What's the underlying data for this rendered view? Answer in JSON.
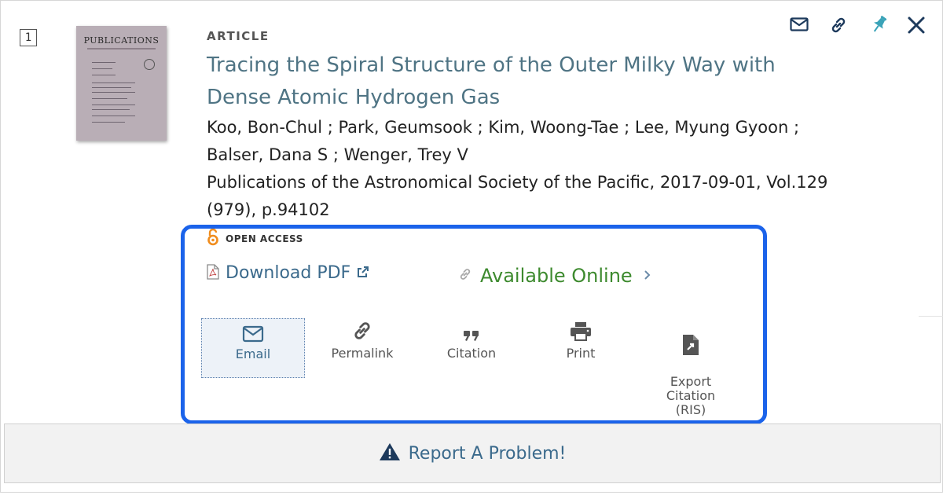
{
  "record": {
    "rank": "1",
    "type": "ARTICLE",
    "title": "Tracing the Spiral Structure of the Outer Milky Way with Dense Atomic Hydrogen Gas",
    "authors": "Koo, Bon-Chul ; Park, Geumsook ; Kim, Woong-Tae ; Lee, Myung Gyoon ; Balser, Dana S ; Wenger, Trey V",
    "source": "Publications of the Astronomical Society of the Pacific, 2017-09-01, Vol.129 (979), p.94102",
    "thumbnail_title": "PUBLICATIONS"
  },
  "top_icons": [
    "envelope-icon",
    "link-icon",
    "pin-icon",
    "close-icon"
  ],
  "open_access_label": "OPEN ACCESS",
  "download": {
    "label": "Download PDF",
    "icon": "pdf-icon"
  },
  "available": {
    "label": "Available Online",
    "icon": "link-icon"
  },
  "actions": [
    {
      "label": "Email",
      "icon": "envelope-icon",
      "selected": true
    },
    {
      "label": "Permalink",
      "icon": "link-icon"
    },
    {
      "label": "Citation",
      "icon": "quote-icon"
    },
    {
      "label": "Print",
      "icon": "printer-icon"
    },
    {
      "label": "Export\nCitation\n(RIS)",
      "icon": "export-file-icon"
    }
  ],
  "report": {
    "label": "Report A Problem!",
    "icon": "warning-icon"
  },
  "colors": {
    "highlight_box": "#1b63ea",
    "title": "#4f7484",
    "available": "#3d8a2e",
    "link": "#3b6a8c"
  }
}
